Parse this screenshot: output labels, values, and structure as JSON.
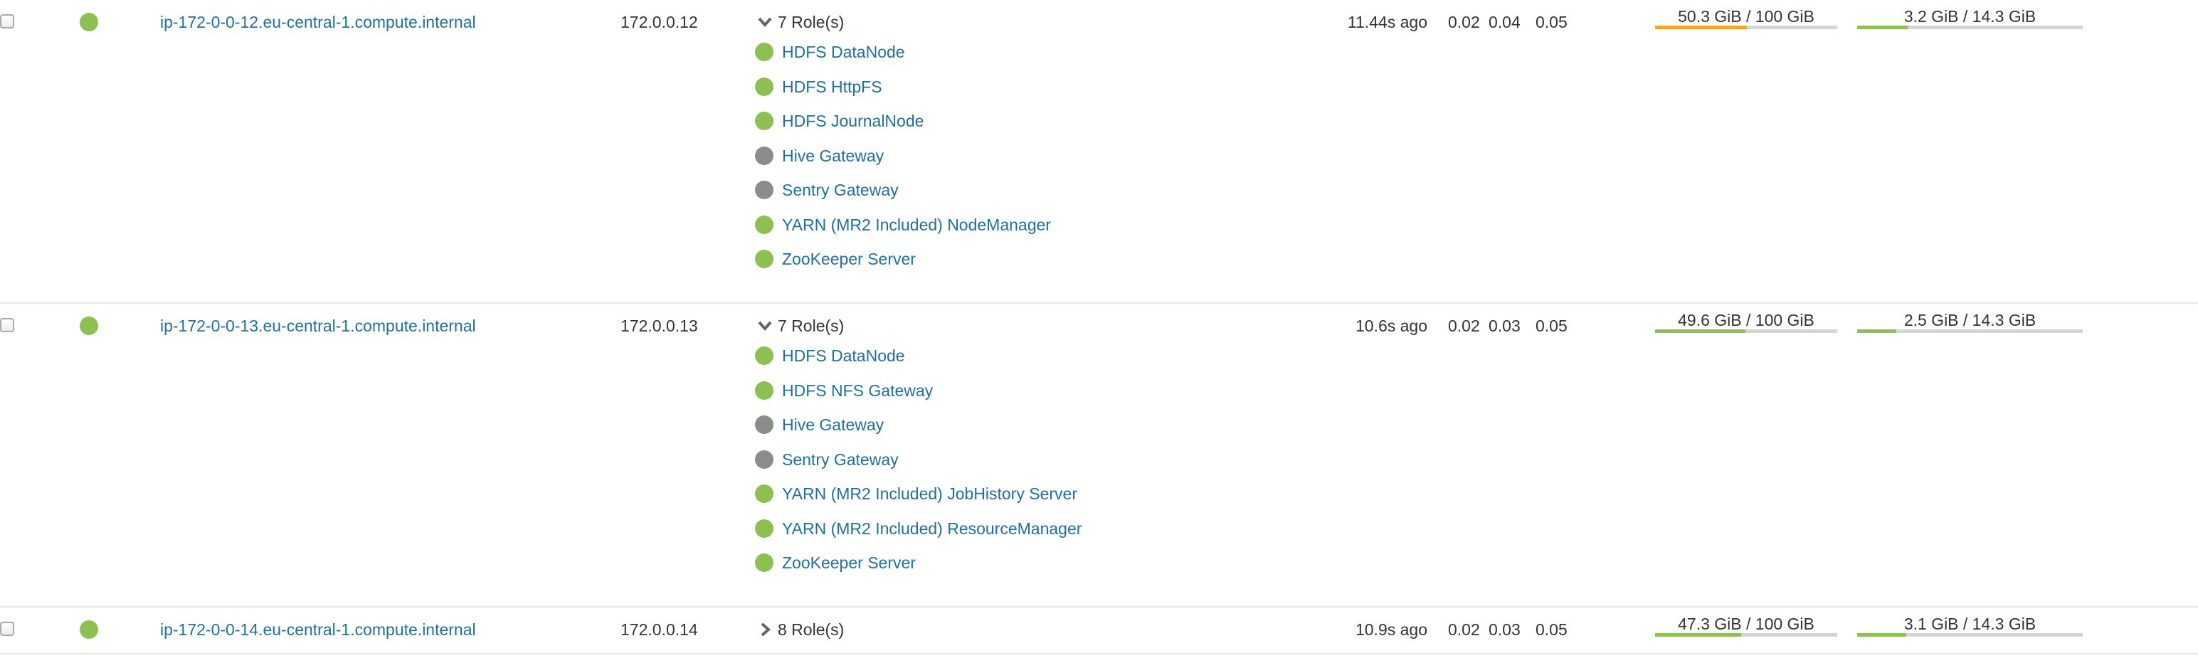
{
  "colors": {
    "good": "#8cc152",
    "stopped": "#8c8c8c",
    "warning": "#f5a623",
    "link": "#1d6fa5",
    "track": "#d5d5d5"
  },
  "hosts": [
    {
      "name": "ip-172-0-0-12.eu-central-1.compute.internal",
      "ip": "172.0.0.12",
      "health": "good",
      "roles_label": "7 Role(s)",
      "roles_expanded": true,
      "roles": [
        {
          "label": "HDFS DataNode",
          "status": "good"
        },
        {
          "label": "HDFS HttpFS",
          "status": "good"
        },
        {
          "label": "HDFS JournalNode",
          "status": "good"
        },
        {
          "label": "Hive Gateway",
          "status": "stopped"
        },
        {
          "label": "Sentry Gateway",
          "status": "stopped"
        },
        {
          "label": "YARN (MR2 Included) NodeManager",
          "status": "good"
        },
        {
          "label": "ZooKeeper Server",
          "status": "good"
        }
      ],
      "last_heartbeat": "11.44s ago",
      "load": [
        "0.02",
        "0.04",
        "0.05"
      ],
      "disk": {
        "label": "50.3 GiB / 100 GiB",
        "fraction": 0.503,
        "status": "warning"
      },
      "memory": {
        "label": "3.2 GiB / 14.3 GiB",
        "fraction": 0.224,
        "status": "good"
      }
    },
    {
      "name": "ip-172-0-0-13.eu-central-1.compute.internal",
      "ip": "172.0.0.13",
      "health": "good",
      "roles_label": "7 Role(s)",
      "roles_expanded": true,
      "roles": [
        {
          "label": "HDFS DataNode",
          "status": "good"
        },
        {
          "label": "HDFS NFS Gateway",
          "status": "good"
        },
        {
          "label": "Hive Gateway",
          "status": "stopped"
        },
        {
          "label": "Sentry Gateway",
          "status": "stopped"
        },
        {
          "label": "YARN (MR2 Included) JobHistory Server",
          "status": "good"
        },
        {
          "label": "YARN (MR2 Included) ResourceManager",
          "status": "good"
        },
        {
          "label": "ZooKeeper Server",
          "status": "good"
        }
      ],
      "last_heartbeat": "10.6s ago",
      "load": [
        "0.02",
        "0.03",
        "0.05"
      ],
      "disk": {
        "label": "49.6 GiB / 100 GiB",
        "fraction": 0.496,
        "status": "good"
      },
      "memory": {
        "label": "2.5 GiB / 14.3 GiB",
        "fraction": 0.175,
        "status": "good"
      }
    },
    {
      "name": "ip-172-0-0-14.eu-central-1.compute.internal",
      "ip": "172.0.0.14",
      "health": "good",
      "roles_label": "8 Role(s)",
      "roles_expanded": false,
      "roles": [],
      "last_heartbeat": "10.9s ago",
      "load": [
        "0.02",
        "0.03",
        "0.05"
      ],
      "disk": {
        "label": "47.3 GiB / 100 GiB",
        "fraction": 0.473,
        "status": "good"
      },
      "memory": {
        "label": "3.1 GiB / 14.3 GiB",
        "fraction": 0.217,
        "status": "good"
      }
    }
  ]
}
